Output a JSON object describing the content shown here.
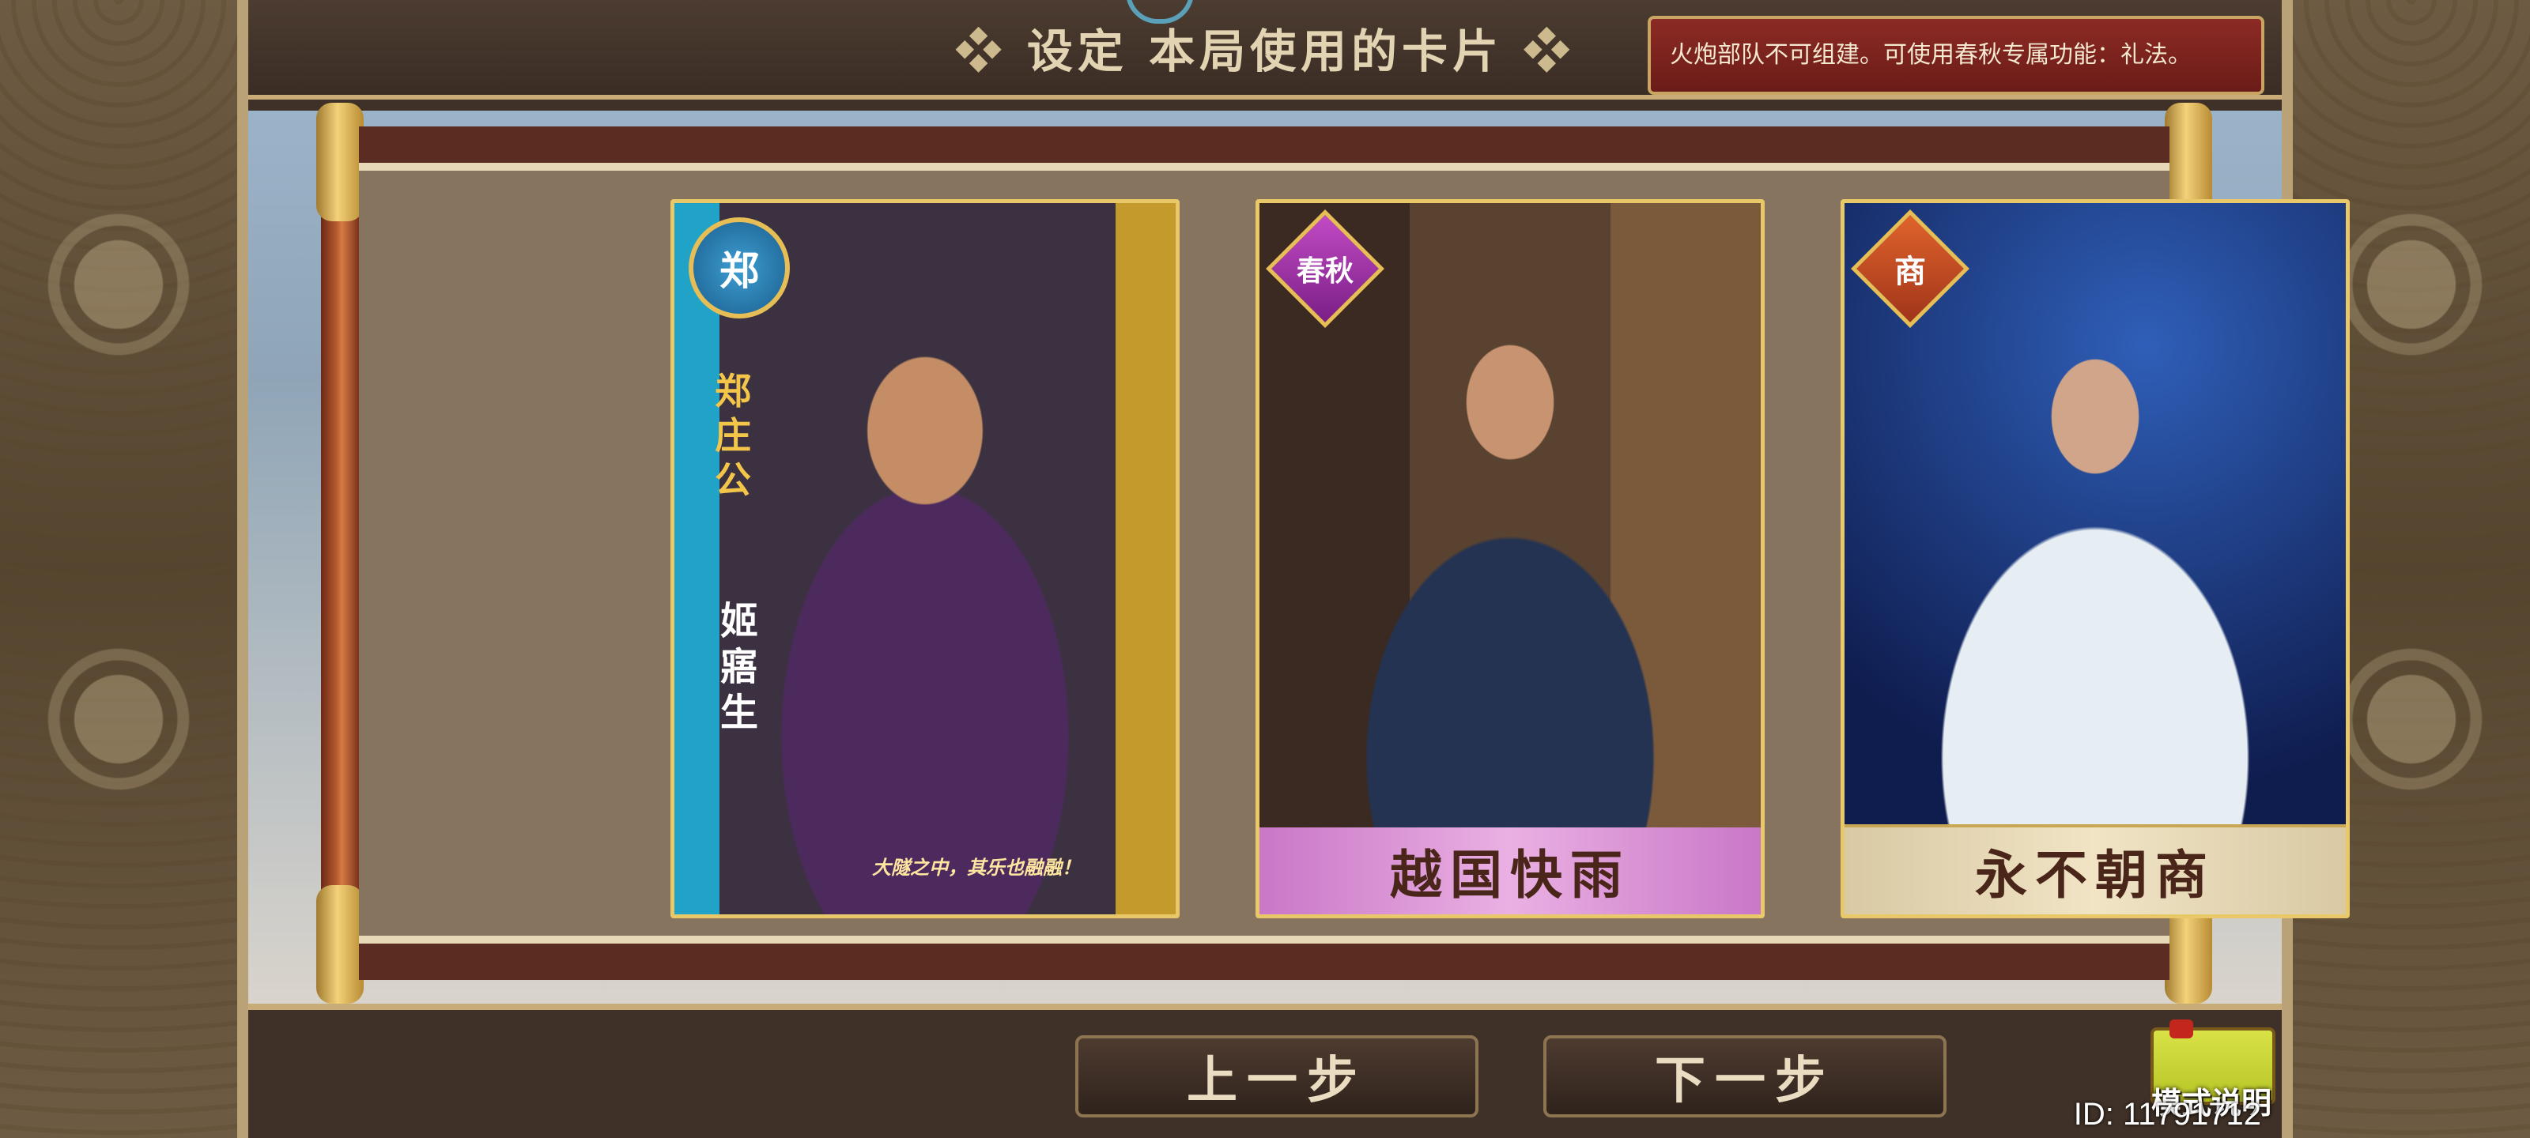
{
  "title": {
    "left_orn": "❖",
    "text": "设定 本局使用的卡片",
    "right_orn": "❖"
  },
  "notice": "火炮部队不可组建。可使用春秋专属功能：礼法。",
  "cards": [
    {
      "badge": "郑",
      "side_text": "郑庄公",
      "name_vertical": "姬寤生",
      "quote": "大隧之中，其乐也融融！"
    },
    {
      "badge": "春秋",
      "caption": "越国快雨"
    },
    {
      "badge": "商",
      "caption": "永不朝商"
    }
  ],
  "buttons": {
    "prev": "上一步",
    "next": "下一步",
    "mode_help": "模式说明"
  },
  "id_label": "ID: 11791712"
}
